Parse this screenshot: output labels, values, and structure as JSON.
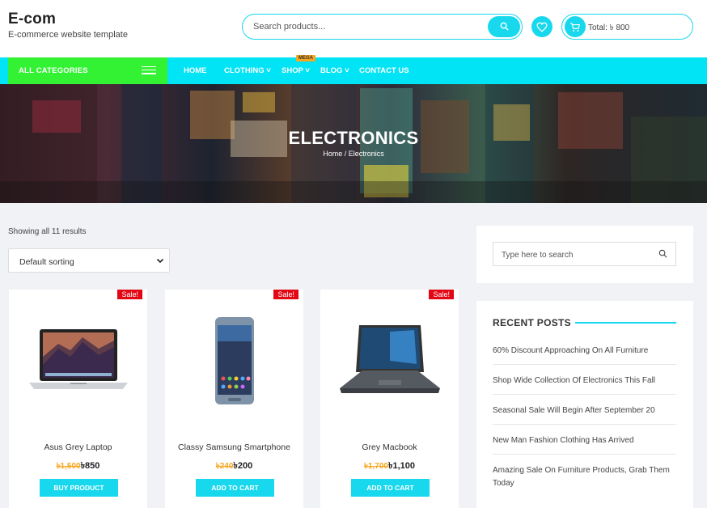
{
  "brand": {
    "title": "E-com",
    "subtitle": "E-commerce website template"
  },
  "search": {
    "placeholder": "Search products..."
  },
  "cart": {
    "total": "Total: ৳ 800"
  },
  "nav": {
    "all_categories": "ALL CATEGORIES",
    "items": [
      "HOME",
      "CLOTHING",
      "SHOP",
      "BLOG",
      "CONTACT US"
    ],
    "mega_badge": "MEGA"
  },
  "hero": {
    "title": "ELECTRONICS",
    "breadcrumb": "Home / Electronics"
  },
  "shop": {
    "showing": "Showing all 11 results",
    "sort": "Default sorting",
    "sale_badge": "Sale!",
    "products": [
      {
        "name": "Asus Grey Laptop",
        "old_price": "৳1,500",
        "price": "৳850",
        "button": "BUY PRODUCT",
        "image_icon": "laptop-mac-icon"
      },
      {
        "name": "Classy Samsung Smartphone",
        "old_price": "৳240",
        "price": "৳200",
        "button": "ADD TO CART",
        "image_icon": "smartphone-icon"
      },
      {
        "name": "Grey Macbook",
        "old_price": "৳1,700",
        "price": "৳1,100",
        "button": "ADD TO CART",
        "image_icon": "laptop-windows-icon"
      }
    ]
  },
  "sidebar": {
    "search_placeholder": "Type here to search",
    "recent_title": "RECENT POSTS",
    "posts": [
      "60% Discount Approaching On All Furniture",
      "Shop Wide Collection Of Electronics This Fall",
      "Seasonal Sale Will Begin After September 20",
      "New Man Fashion Clothing Has Arrived",
      "Amazing Sale On Furniture Products, Grab Them Today"
    ]
  },
  "colors": {
    "accent": "#18d8ee",
    "nav": "#00e4f5",
    "categories": "#33f233",
    "sale": "#e30613",
    "old_price": "#f5a623"
  }
}
